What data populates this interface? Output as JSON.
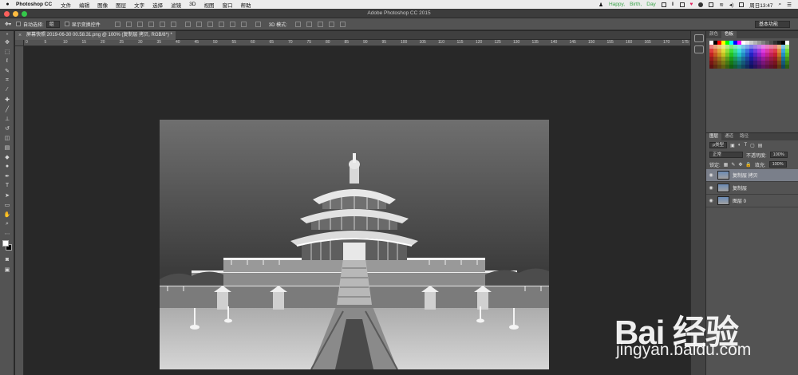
{
  "menubar": {
    "app": "Photoshop CC",
    "items": [
      "文件",
      "编辑",
      "图像",
      "图层",
      "文字",
      "选择",
      "滤镜",
      "3D",
      "视图",
      "窗口",
      "帮助"
    ],
    "status": [
      "Happy,",
      "Birth,",
      "Day"
    ],
    "clock": "周日13:47"
  },
  "titlebar": {
    "title": "Adobe Photoshop CC 2015"
  },
  "options": {
    "auto_select": "自动选择:",
    "auto_select_value": "组",
    "show_transform": "显示变换控件",
    "mode_3d": "3D 模式:",
    "workspace": "基本功能"
  },
  "document": {
    "tab": "屏幕快照 2019-06-30 00.58.31.png @ 100% (复制层 拷贝, RGB/8*) *",
    "ruler_ticks": [
      "0",
      "5",
      "10",
      "15",
      "20",
      "25",
      "30",
      "35",
      "40",
      "45",
      "50",
      "55",
      "60",
      "65",
      "70",
      "75",
      "80",
      "85",
      "90",
      "95",
      "100",
      "105",
      "110",
      "115",
      "120",
      "125",
      "130",
      "135",
      "140",
      "145",
      "150",
      "155",
      "160",
      "165",
      "170",
      "175"
    ]
  },
  "panels": {
    "swatch_tabs": [
      "颜色",
      "色板"
    ],
    "layer_tabs": [
      "图层",
      "通道",
      "路径"
    ],
    "filter_label": "ρ类型",
    "blend_mode": "正常",
    "opacity_label": "不透明度:",
    "opacity_value": "100%",
    "lock_label": "锁定:",
    "fill_label": "填充:",
    "fill_value": "100%",
    "layers": [
      {
        "name": "复制层 拷贝",
        "active": true
      },
      {
        "name": "复制层",
        "active": false
      },
      {
        "name": "图层 0",
        "active": false
      }
    ]
  },
  "watermark": {
    "logo": "Bai 经验",
    "url": "jingyan.baidu.com"
  },
  "colors": {
    "menubar": "#ececec",
    "chrome": "#535353",
    "canvas": "#282828",
    "active_layer": "#7a7f8a"
  }
}
